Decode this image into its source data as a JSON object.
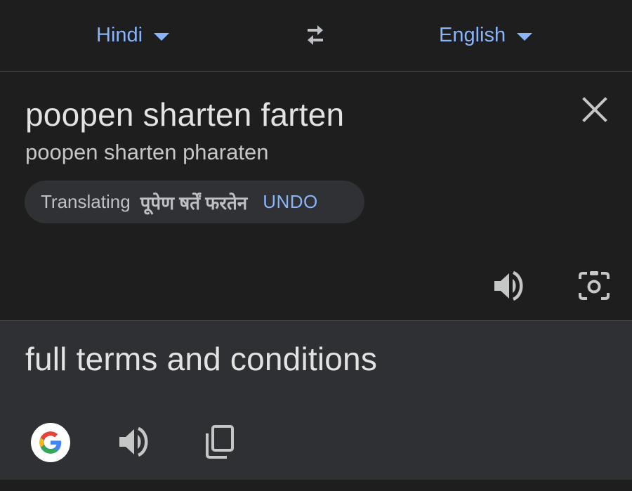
{
  "header": {
    "source_language": "Hindi",
    "target_language": "English",
    "swap_icon": "swap-arrows-icon"
  },
  "input": {
    "text": "poopen sharten farten",
    "transliteration": "poopen sharten pharaten",
    "suggestion_chip": {
      "label": "Translating",
      "hindi_text": "पूपेण षर्तें फरतेन",
      "undo_label": "UNDO"
    },
    "icons": [
      "close-icon",
      "speaker-icon",
      "camera-icon"
    ]
  },
  "output": {
    "text": "full terms and conditions",
    "icons": [
      "google-logo-icon",
      "speaker-icon",
      "copy-icon"
    ]
  },
  "colors": {
    "accent": "#8ab4f8",
    "background": "#1e1e1f",
    "output_background": "#2f3033",
    "text": "#e3e3e3"
  }
}
